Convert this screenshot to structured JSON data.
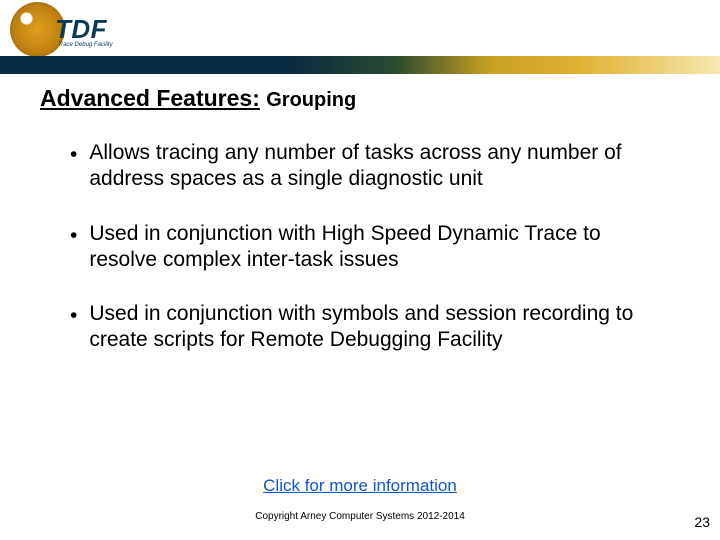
{
  "logo": {
    "text": "TDF",
    "subtext": "Trace Debug Facility"
  },
  "title": {
    "main": "Advanced Features:",
    "sub": "Grouping"
  },
  "bullets": [
    "Allows tracing any number of tasks across any number of address spaces as a single diagnostic unit",
    "Used in conjunction with High Speed Dynamic Trace to resolve complex inter-task issues",
    "Used in conjunction with symbols and session recording to create scripts for Remote Debugging Facility"
  ],
  "more_link": "Click for more information",
  "copyright": "Copyright Arney Computer Systems 2012-2014",
  "page_number": "23"
}
